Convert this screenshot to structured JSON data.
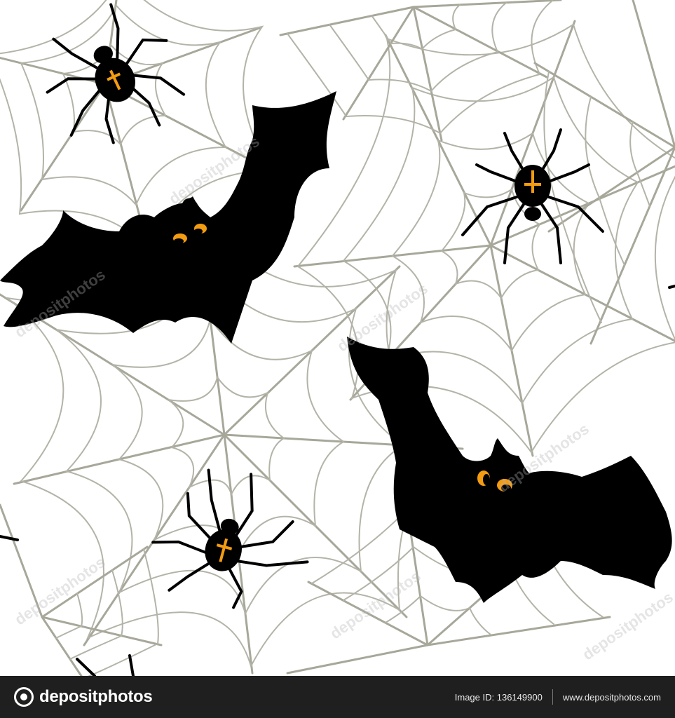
{
  "artwork": {
    "description_icons": [
      "spider-icon",
      "bat-icon",
      "cobweb"
    ],
    "colors": {
      "web": "#a7a79a",
      "silhouette": "#000000",
      "eyes": "#f39c12",
      "cross": "#f39c12",
      "background": "#ffffff",
      "footer": "#1f1f1f"
    }
  },
  "watermark": {
    "text": "depositphotos"
  },
  "footer": {
    "logo_text": "depositphotos",
    "image_id": "Image ID: 136149900",
    "site": "www.depositphotos.com"
  }
}
